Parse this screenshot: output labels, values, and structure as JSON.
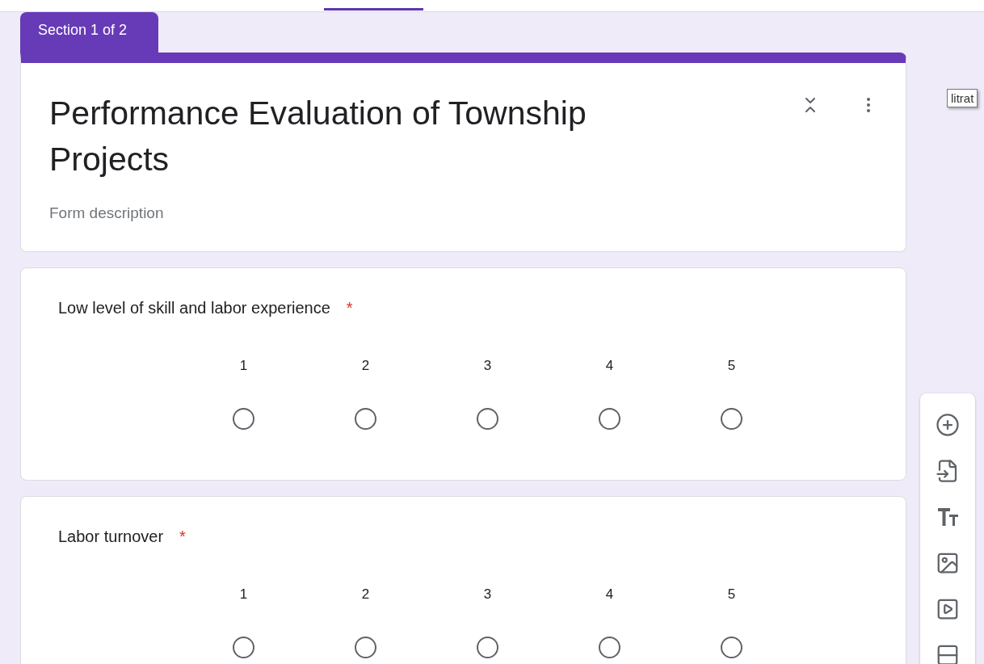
{
  "section_tab": {
    "label": "Section 1 of 2"
  },
  "form": {
    "title": "Performance Evaluation of Township Projects",
    "description_placeholder": "Form description"
  },
  "questions": [
    {
      "text": "Low level of skill and labor experience",
      "required_mark": "*",
      "options": [
        {
          "label": "1",
          "selected": false
        },
        {
          "label": "2",
          "selected": false
        },
        {
          "label": "3",
          "selected": false
        },
        {
          "label": "4",
          "selected": false
        },
        {
          "label": "5",
          "selected": false
        }
      ]
    },
    {
      "text": "Labor turnover",
      "required_mark": "*",
      "options": [
        {
          "label": "1",
          "selected": false
        },
        {
          "label": "2",
          "selected": false
        },
        {
          "label": "3",
          "selected": false
        },
        {
          "label": "4",
          "selected": false
        },
        {
          "label": "5",
          "selected": false
        }
      ]
    }
  ],
  "tooltip": "litrat",
  "toolbar": [
    {
      "kind": "add"
    },
    {
      "kind": "import"
    },
    {
      "kind": "title"
    },
    {
      "kind": "image"
    },
    {
      "kind": "video"
    },
    {
      "kind": "section"
    }
  ]
}
